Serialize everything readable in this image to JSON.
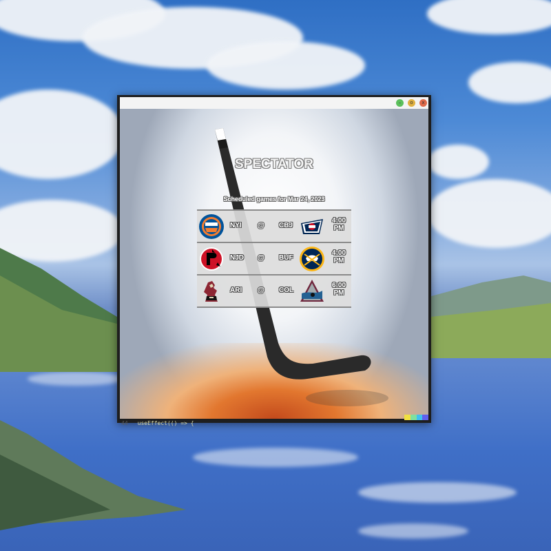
{
  "app": {
    "title": "SPECTATOR",
    "subtitle": "Scheduled games for Mar 24, 2023"
  },
  "window_controls": [
    {
      "name": "minimize",
      "glyph": "–",
      "color": "#5bbf5b"
    },
    {
      "name": "maximize",
      "glyph": "o",
      "color": "#e0b040"
    },
    {
      "name": "close",
      "glyph": "x",
      "color": "#e06a4a"
    }
  ],
  "games": [
    {
      "away": "NYI",
      "at": "@",
      "home": "CBJ",
      "time_line1": "4:00",
      "time_line2": "PM",
      "away_logo": "islanders-logo",
      "home_logo": "blue-jackets-logo"
    },
    {
      "away": "NJD",
      "at": "@",
      "home": "BUF",
      "time_line1": "4:00",
      "time_line2": "PM",
      "away_logo": "devils-logo",
      "home_logo": "sabres-logo"
    },
    {
      "away": "ARI",
      "at": "@",
      "home": "COL",
      "time_line1": "6:00",
      "time_line2": "PM",
      "away_logo": "coyotes-logo",
      "home_logo": "avalanche-logo"
    }
  ],
  "background_code": {
    "line_number": "44",
    "text": "useEffect(() => {"
  },
  "colors": {
    "title_text": "#f6f6f6",
    "row_background": "#dcdcdc",
    "row_border": "#8a8a8a"
  }
}
